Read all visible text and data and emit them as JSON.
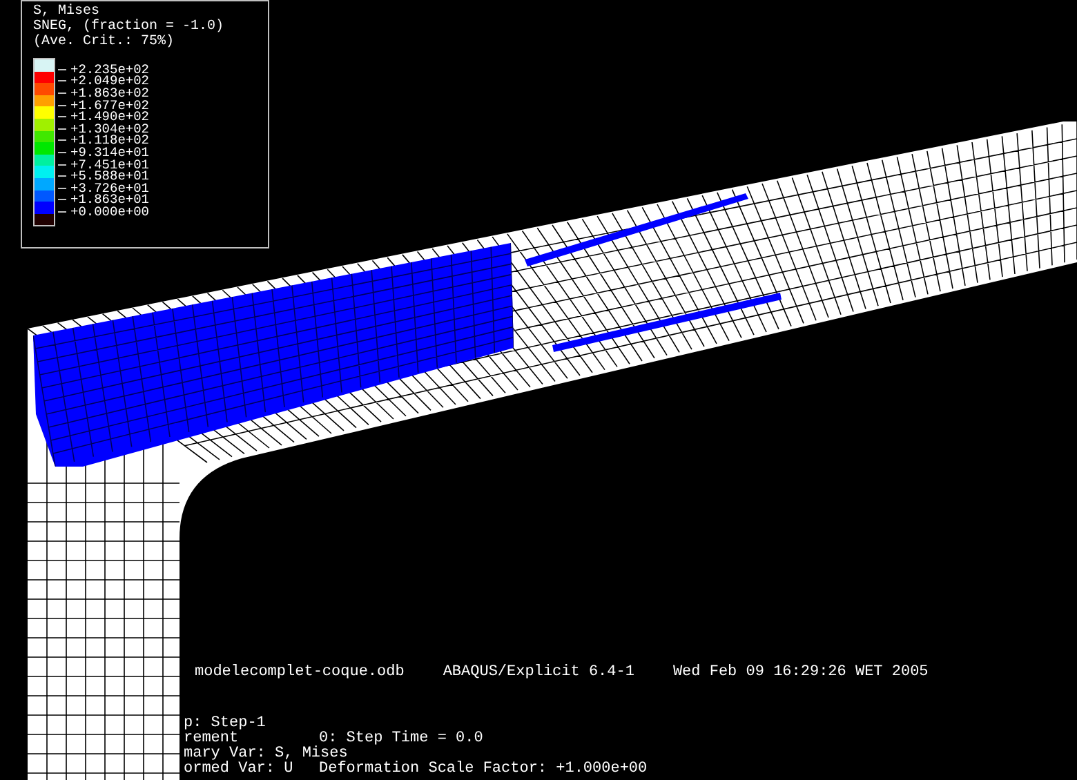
{
  "legend": {
    "lines": [
      "S, Mises",
      "SNEG, (fraction = -1.0)",
      "(Ave. Crit.: 75%)"
    ],
    "swatches": [
      {
        "color": "#d8f4f4"
      },
      {
        "color": "#ff0000"
      },
      {
        "color": "#ff4a00"
      },
      {
        "color": "#ffa000"
      },
      {
        "color": "#ffff00"
      },
      {
        "color": "#a0f000"
      },
      {
        "color": "#40e800"
      },
      {
        "color": "#00e800"
      },
      {
        "color": "#00f0a0"
      },
      {
        "color": "#00f0f0"
      },
      {
        "color": "#00a8ff"
      },
      {
        "color": "#0058ff"
      },
      {
        "color": "#0000ff"
      },
      {
        "color": "#200000"
      }
    ],
    "values": [
      "+2.235e+02",
      "+2.049e+02",
      "+1.863e+02",
      "+1.677e+02",
      "+1.490e+02",
      "+1.304e+02",
      "+1.118e+02",
      "+9.314e+01",
      "+7.451e+01",
      "+5.588e+01",
      "+3.726e+01",
      "+1.863e+01",
      "+0.000e+00"
    ]
  },
  "header": {
    "file": "modelecomplet-coque.odb",
    "solver": "ABAQUS/Explicit 6.4-1",
    "date": "Wed Feb 09 16:29:26 WET 2005"
  },
  "info": [
    {
      "label": "p: Step-1"
    },
    {
      "label": "rement",
      "value": "0: Step Time = 0.0"
    },
    {
      "label": "mary Var: S, Mises"
    },
    {
      "label": "ormed Var: U",
      "value": "Deformation Scale Factor: +1.000e+00"
    }
  ]
}
